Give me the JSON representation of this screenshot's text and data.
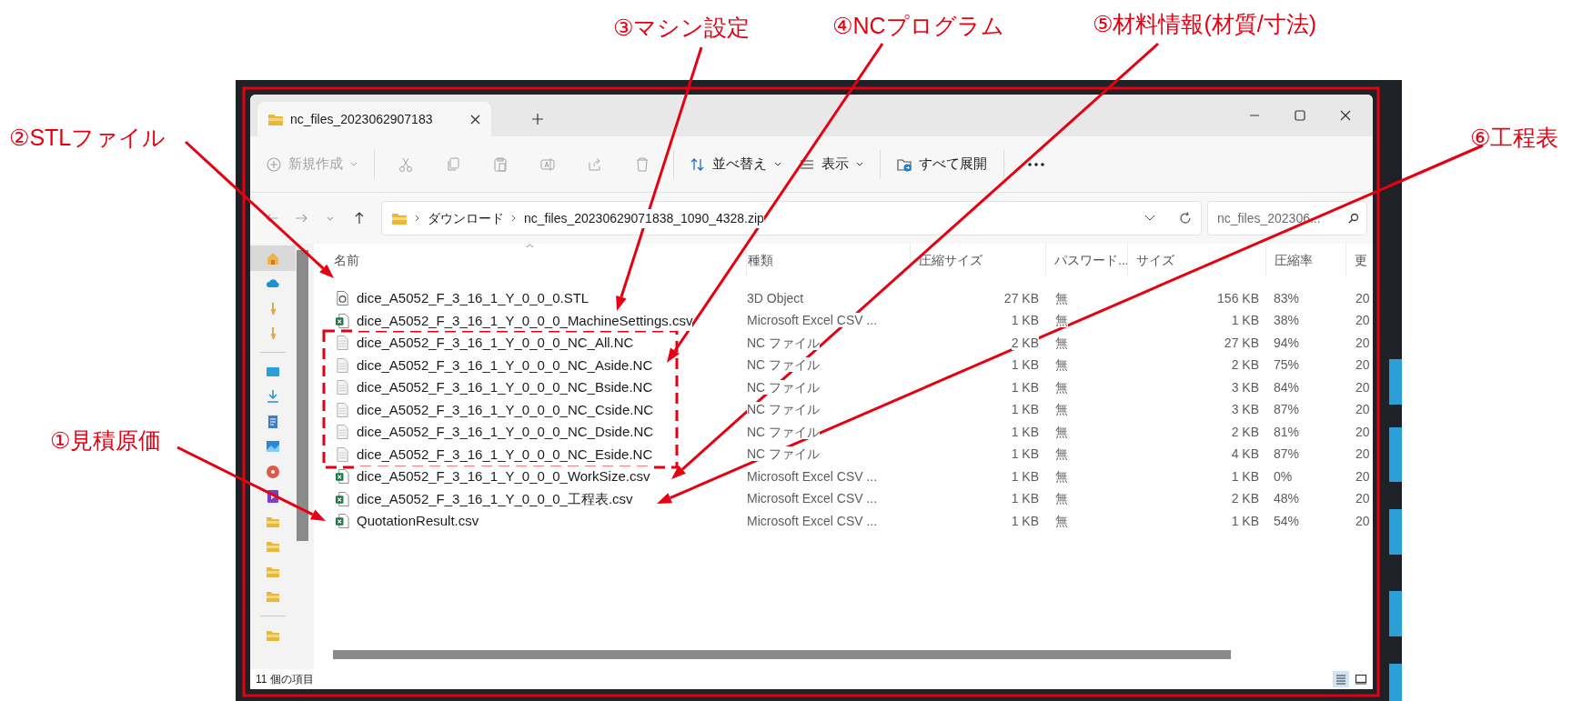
{
  "annotations": [
    {
      "label": "①見積原価"
    },
    {
      "label": "②STLファイル"
    },
    {
      "label": "③マシン設定"
    },
    {
      "label": "④NCプログラム"
    },
    {
      "label": "⑤材料情報(材質/寸法)"
    },
    {
      "label": "⑥工程表"
    }
  ],
  "tabs": [
    {
      "title": "nc_files_2023062907183",
      "selected": true
    }
  ],
  "toolbar": [
    {
      "kind": "new",
      "label": "新規作成",
      "disabled": true
    },
    {
      "kind": "cut",
      "disabled": true
    },
    {
      "kind": "copy",
      "disabled": true
    },
    {
      "kind": "paste",
      "disabled": true
    },
    {
      "kind": "rename",
      "disabled": true
    },
    {
      "kind": "share",
      "disabled": true
    },
    {
      "kind": "delete",
      "disabled": true
    },
    {
      "kind": "sort",
      "label": "並べ替え",
      "disabled": false
    },
    {
      "kind": "view",
      "label": "表示",
      "disabled": false
    },
    {
      "kind": "extract",
      "label": "すべて展開",
      "disabled": false
    },
    {
      "kind": "more"
    }
  ],
  "nav_buttons": [
    {
      "kind": "back",
      "disabled": true
    },
    {
      "kind": "forward",
      "disabled": true
    },
    {
      "kind": "recent",
      "disabled": true
    },
    {
      "kind": "up",
      "disabled": false
    }
  ],
  "breadcrumb": [
    "ダウンロード",
    "nc_files_20230629071838_1090_4328.zip"
  ],
  "search": {
    "placeholder": "nc_files_202306..."
  },
  "sidebar": {
    "groups": [
      {
        "items": [
          {
            "kind": "home",
            "selected": true
          },
          {
            "kind": "cloud",
            "selected": false
          },
          {
            "kind": "pin",
            "selected": false
          },
          {
            "kind": "pin",
            "selected": false
          }
        ]
      },
      {
        "items": [
          {
            "kind": "desktop",
            "selected": false
          },
          {
            "kind": "download",
            "selected": false
          },
          {
            "kind": "document",
            "selected": false
          },
          {
            "kind": "picture",
            "selected": false
          },
          {
            "kind": "music",
            "selected": false
          },
          {
            "kind": "video",
            "selected": false
          },
          {
            "kind": "folder",
            "selected": false
          },
          {
            "kind": "folder",
            "selected": false
          },
          {
            "kind": "folder",
            "selected": false
          },
          {
            "kind": "folder",
            "selected": false
          }
        ]
      },
      {
        "items": [
          {
            "kind": "folder",
            "selected": false
          }
        ]
      }
    ]
  },
  "table": {
    "columns": [
      "名前",
      "種類",
      "圧縮サイズ",
      "パスワード...",
      "サイズ",
      "圧縮率",
      "更"
    ],
    "rows": [
      {
        "kind": "stl",
        "name": "dice_A5052_F_3_16_1_Y_0_0_0.STL",
        "type": "3D Object",
        "packed": "27 KB",
        "password": "無",
        "size": "156 KB",
        "ratio": "83%",
        "column_7": "20"
      },
      {
        "kind": "csv",
        "name": "dice_A5052_F_3_16_1_Y_0_0_0_MachineSettings.csv",
        "type": "Microsoft Excel CSV ...",
        "packed": "1 KB",
        "password": "無",
        "size": "1 KB",
        "ratio": "38%",
        "column_7": "20"
      },
      {
        "kind": "nc",
        "name": "dice_A5052_F_3_16_1_Y_0_0_0_NC_All.NC",
        "type": "NC ファイル",
        "packed": "2 KB",
        "password": "無",
        "size": "27 KB",
        "ratio": "94%",
        "column_7": "20"
      },
      {
        "kind": "nc",
        "name": "dice_A5052_F_3_16_1_Y_0_0_0_NC_Aside.NC",
        "type": "NC ファイル",
        "packed": "1 KB",
        "password": "無",
        "size": "2 KB",
        "ratio": "75%",
        "column_7": "20"
      },
      {
        "kind": "nc",
        "name": "dice_A5052_F_3_16_1_Y_0_0_0_NC_Bside.NC",
        "type": "NC ファイル",
        "packed": "1 KB",
        "password": "無",
        "size": "3 KB",
        "ratio": "84%",
        "column_7": "20"
      },
      {
        "kind": "nc",
        "name": "dice_A5052_F_3_16_1_Y_0_0_0_NC_Cside.NC",
        "type": "NC ファイル",
        "packed": "1 KB",
        "password": "無",
        "size": "3 KB",
        "ratio": "87%",
        "column_7": "20"
      },
      {
        "kind": "nc",
        "name": "dice_A5052_F_3_16_1_Y_0_0_0_NC_Dside.NC",
        "type": "NC ファイル",
        "packed": "1 KB",
        "password": "無",
        "size": "2 KB",
        "ratio": "81%",
        "column_7": "20"
      },
      {
        "kind": "nc",
        "name": "dice_A5052_F_3_16_1_Y_0_0_0_NC_Eside.NC",
        "type": "NC ファイル",
        "packed": "1 KB",
        "password": "無",
        "size": "4 KB",
        "ratio": "87%",
        "column_7": "20"
      },
      {
        "kind": "csv",
        "name": "dice_A5052_F_3_16_1_Y_0_0_0_WorkSize.csv",
        "type": "Microsoft Excel CSV ...",
        "packed": "1 KB",
        "password": "無",
        "size": "1 KB",
        "ratio": "0%",
        "column_7": "20"
      },
      {
        "kind": "csv",
        "name": "dice_A5052_F_3_16_1_Y_0_0_0_工程表.csv",
        "type": "Microsoft Excel CSV ...",
        "packed": "1 KB",
        "password": "無",
        "size": "2 KB",
        "ratio": "48%",
        "column_7": "20"
      },
      {
        "kind": "csv",
        "name": "QuotationResult.csv",
        "type": "Microsoft Excel CSV ...",
        "packed": "1 KB",
        "password": "無",
        "size": "1 KB",
        "ratio": "54%",
        "column_7": "20"
      }
    ]
  },
  "status_bar": {
    "text": "11 個の項目"
  },
  "view_buttons": [
    {
      "kind": "details",
      "selected": true
    },
    {
      "kind": "tiles",
      "selected": false
    }
  ]
}
